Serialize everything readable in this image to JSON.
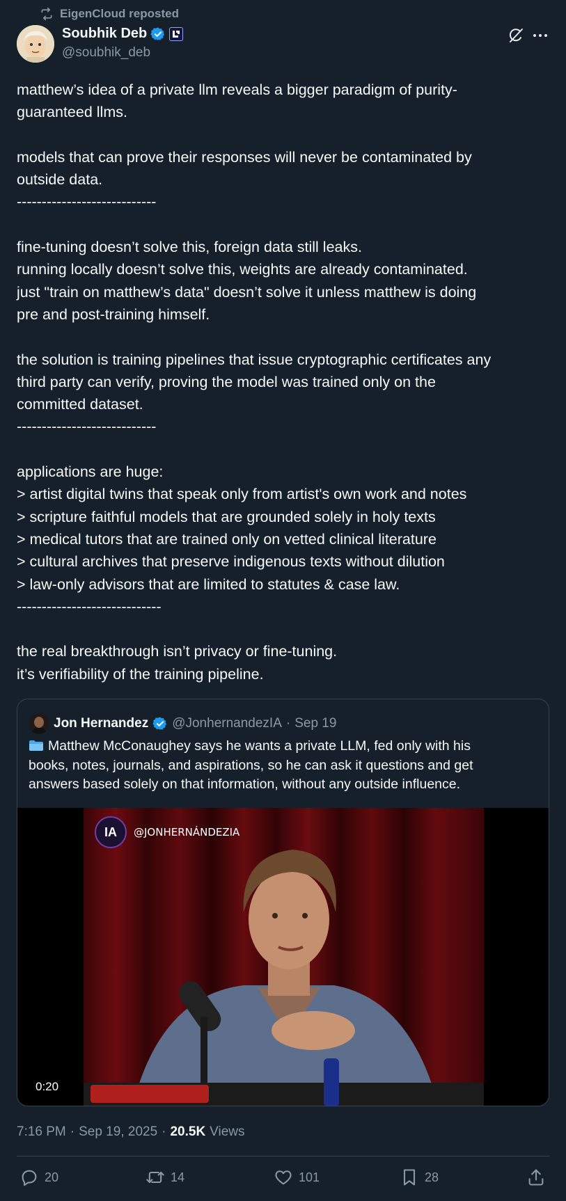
{
  "repost": {
    "label": "EigenCloud reposted",
    "icon": "repost-icon"
  },
  "author": {
    "name": "Soubhik Deb",
    "handle": "@soubhik_deb",
    "verified": true,
    "badge": "affiliate-badge"
  },
  "tweet": {
    "lines": [
      "matthew’s idea of a private llm reveals a bigger paradigm of purity-",
      "guaranteed llms.",
      "",
      "models that can prove their responses will never be contaminated by",
      "outside data.",
      "----------------------------",
      "",
      "fine-tuning doesn’t solve this, foreign data still leaks.",
      "running locally doesn’t solve this, weights are already contaminated.",
      "just \"train on matthew’s data\" doesn’t solve it unless matthew is doing",
      "pre and post-training himself.",
      "",
      "the solution is training pipelines that issue cryptographic certificates any",
      "third party can verify, proving the model was trained only on the",
      "committed dataset.",
      "----------------------------",
      "",
      "applications are huge:",
      "> artist digital twins that speak only from artist's own work and notes",
      "> scripture faithful models that are grounded solely in holy texts",
      "> medical tutors that are trained only on vetted clinical literature",
      "> cultural archives that preserve indigenous texts without dilution",
      "> law-only advisors that are limited to statutes & case law.",
      "-----------------------------",
      "",
      "the real breakthrough isn’t privacy or fine-tuning.",
      "it’s verifiability of the training pipeline."
    ]
  },
  "quote": {
    "name": "Jon Hernandez",
    "handle": "@JonhernandezIA",
    "separator": "·",
    "date": "Sep 19",
    "lines": [
      "Matthew McConaughey says he wants a private LLM, fed only with his",
      "books, notes, journals, and aspirations, so he can ask it questions and get",
      "answers based solely on that information, without any outside influence."
    ],
    "media": {
      "watermark_logo": "IA",
      "watermark_text": "@JONHERNÁNDEZIA",
      "duration": "0:20"
    }
  },
  "meta": {
    "time": "7:16 PM",
    "sep1": "·",
    "date": "Sep 19, 2025",
    "sep2": "·",
    "views_count": "20.5K",
    "views_label": "Views"
  },
  "actions": {
    "replies": "20",
    "reposts": "14",
    "likes": "101",
    "bookmarks": "28"
  },
  "colors": {
    "background": "#15202b",
    "text": "#f7f9f9",
    "muted": "#8b98a5",
    "border": "#38444d",
    "verified": "#1d9bf0"
  }
}
